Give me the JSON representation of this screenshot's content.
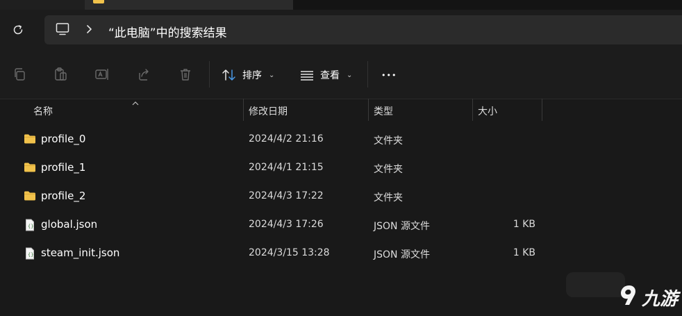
{
  "address": {
    "location_icon": "computer-icon",
    "path_text": "“此电脑”中的搜索结果"
  },
  "toolbar": {
    "icons": [
      "copy-icon",
      "paste-icon",
      "rename-icon",
      "share-icon",
      "delete-icon"
    ],
    "sort_label": "排序",
    "view_label": "查看",
    "more_label": "•••"
  },
  "columns": {
    "name": "名称",
    "modified": "修改日期",
    "type": "类型",
    "size": "大小"
  },
  "files": [
    {
      "name": "profile_0",
      "modified": "2024/4/2 21:16",
      "type": "文件夹",
      "size": "",
      "icon": "folder-icon"
    },
    {
      "name": "profile_1",
      "modified": "2024/4/1 21:15",
      "type": "文件夹",
      "size": "",
      "icon": "folder-icon"
    },
    {
      "name": "profile_2",
      "modified": "2024/4/3 17:22",
      "type": "文件夹",
      "size": "",
      "icon": "folder-icon"
    },
    {
      "name": "global.json",
      "modified": "2024/4/3 17:26",
      "type": "JSON 源文件",
      "size": "1 KB",
      "icon": "json-file-icon"
    },
    {
      "name": "steam_init.json",
      "modified": "2024/3/15 13:28",
      "type": "JSON 源文件",
      "size": "1 KB",
      "icon": "json-file-icon"
    }
  ],
  "watermark": {
    "text": "九游"
  },
  "colors": {
    "background": "#191919",
    "folder": "#f1c24b",
    "accent": "#4a9ae8"
  }
}
